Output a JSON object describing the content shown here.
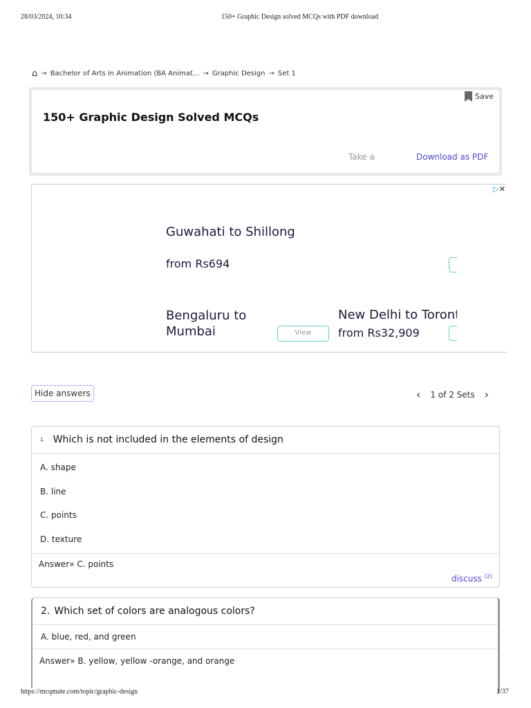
{
  "print_header": {
    "datetime": "28/03/2024, 10:34",
    "title": "150+ Graphic Design solved MCQs with PDF download"
  },
  "breadcrumb": [
    "Bachelor of Arts in Animation (BA Animat...",
    "Graphic Design",
    "Set 1"
  ],
  "card": {
    "title": "150+ Graphic Design Solved MCQs",
    "save": "Save",
    "take": "Take a",
    "download": "Download as PDF"
  },
  "ad": {
    "r1_title": "Guwahati to Shillong",
    "r1_price": "from Rs694",
    "r2_title": "Bengaluru to Mumbai",
    "r2_btn": "View",
    "r3_title": "New Delhi to Toront c",
    "r3_price": "from Rs32,909"
  },
  "controls": {
    "hide": "Hide answers",
    "sets": "1 of 2 Sets"
  },
  "q1": {
    "num": "1.",
    "text": "Which is not included in the elements of design",
    "options": [
      "A.  shape",
      "B.  line",
      "C.  points",
      "D.  texture"
    ],
    "answer": "Answer» C. points",
    "discuss": "discuss",
    "discuss_count": "(2)"
  },
  "q2": {
    "num": "2.",
    "text": "Which set of colors are analogous colors?",
    "options": [
      "A.  blue, red, and green"
    ],
    "answer": "Answer» B. yellow, yellow -orange, and orange"
  },
  "print_footer": {
    "url": "https://mcqmate.com/topic/graphic-design",
    "page": "1/37"
  }
}
